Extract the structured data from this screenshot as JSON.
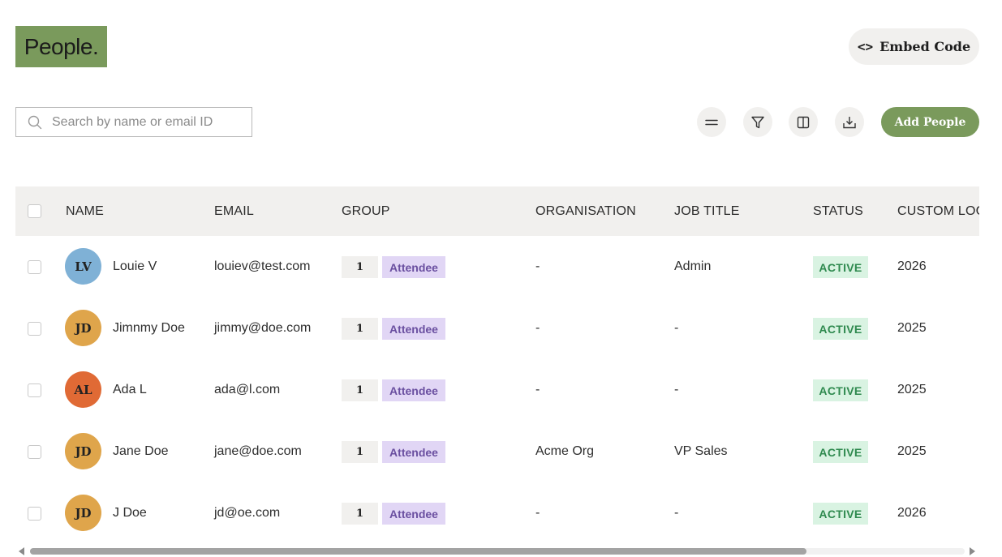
{
  "page": {
    "title": "People."
  },
  "header": {
    "embed_label": "Embed Code",
    "embed_glyph": "<>"
  },
  "search": {
    "placeholder": "Search by name or email ID",
    "value": ""
  },
  "toolbar": {
    "add_label": "Add People",
    "icons": [
      "list-density-icon",
      "filter-icon",
      "columns-icon",
      "download-icon"
    ]
  },
  "colors": {
    "brand": "#7a9a5c",
    "surface": "#f1f0ee",
    "tag_bg": "#e1d6f5",
    "tag_text": "#6a4fa0",
    "status_bg": "#d9f3e2",
    "status_text": "#2f8a4f"
  },
  "table": {
    "columns": [
      "NAME",
      "EMAIL",
      "GROUP",
      "ORGANISATION",
      "JOB TITLE",
      "STATUS",
      "CUSTOM LOG"
    ],
    "rows": [
      {
        "initials": "LV",
        "avatar_color": "#7fb1d6",
        "name": "Louie V",
        "email": "louiev@test.com",
        "group_count": "1",
        "group": "Attendee",
        "organisation": "-",
        "job_title": "Admin",
        "status": "ACTIVE",
        "custom": "2026"
      },
      {
        "initials": "JD",
        "avatar_color": "#dfa54b",
        "name": "Jimnmy Doe",
        "email": "jimmy@doe.com",
        "group_count": "1",
        "group": "Attendee",
        "organisation": "-",
        "job_title": "-",
        "status": "ACTIVE",
        "custom": "2025"
      },
      {
        "initials": "AL",
        "avatar_color": "#e06a35",
        "name": "Ada L",
        "email": "ada@l.com",
        "group_count": "1",
        "group": "Attendee",
        "organisation": "-",
        "job_title": "-",
        "status": "ACTIVE",
        "custom": "2025"
      },
      {
        "initials": "JD",
        "avatar_color": "#dfa54b",
        "name": "Jane Doe",
        "email": "jane@doe.com",
        "group_count": "1",
        "group": "Attendee",
        "organisation": "Acme Org",
        "job_title": "VP Sales",
        "status": "ACTIVE",
        "custom": "2025"
      },
      {
        "initials": "JD",
        "avatar_color": "#dfa54b",
        "name": "J Doe",
        "email": "jd@oe.com",
        "group_count": "1",
        "group": "Attendee",
        "organisation": "-",
        "job_title": "-",
        "status": "ACTIVE",
        "custom": "2026"
      }
    ]
  }
}
